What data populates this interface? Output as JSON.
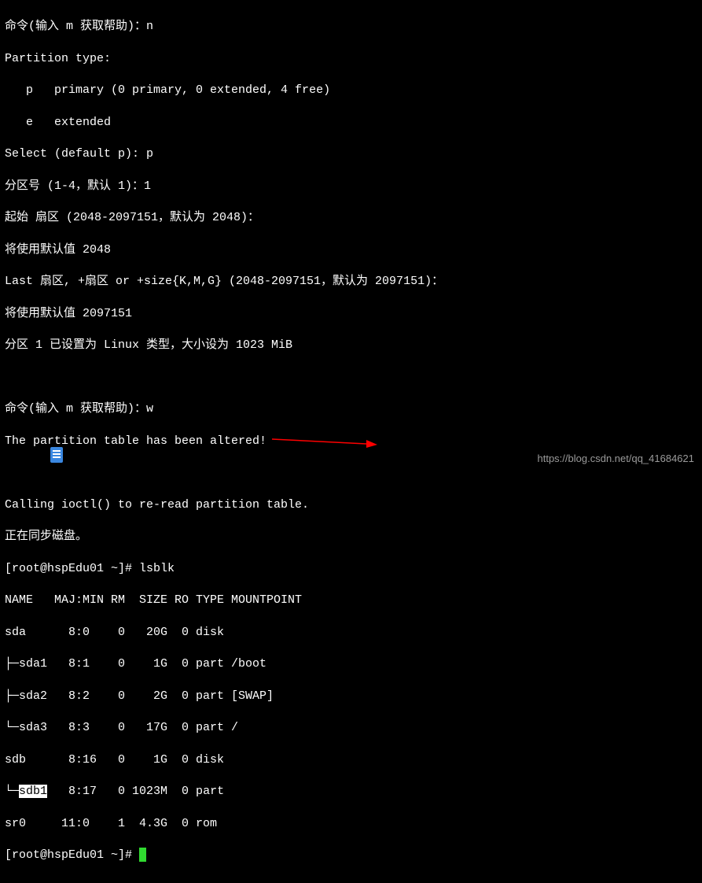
{
  "lines": {
    "l1": "命令(输入 m 获取帮助)：n",
    "l2": "Partition type:",
    "l3": "   p   primary (0 primary, 0 extended, 4 free)",
    "l4": "   e   extended",
    "l5": "Select (default p): p",
    "l6": "分区号 (1-4，默认 1)：1",
    "l7": "起始 扇区 (2048-2097151，默认为 2048)：",
    "l8": "将使用默认值 2048",
    "l9": "Last 扇区, +扇区 or +size{K,M,G} (2048-2097151，默认为 2097151)：",
    "l10": "将使用默认值 2097151",
    "l11": "分区 1 已设置为 Linux 类型，大小设为 1023 MiB",
    "l12": " ",
    "l13": "命令(输入 m 获取帮助)：w",
    "l14": "The partition table has been altered!",
    "l15": " ",
    "l16": "Calling ioctl() to re-read partition table.",
    "l17": "正在同步磁盘。",
    "l18": "[root@hspEdu01 ~]# lsblk",
    "l19": "NAME   MAJ:MIN RM  SIZE RO TYPE MOUNTPOINT",
    "l20": "sda      8:0    0   20G  0 disk ",
    "l21": "├─sda1   8:1    0    1G  0 part /boot",
    "l22": "├─sda2   8:2    0    2G  0 part [SWAP]",
    "l23": "└─sda3   8:3    0   17G  0 part /",
    "l24": "sdb      8:16   0    1G  0 disk ",
    "l25a": "└─",
    "l25b": "sdb1",
    "l25c": "   8:17   0 1023M  0 part ",
    "l26": "sr0     11:0    1  4.3G  0 rom  ",
    "l27": "[root@hspEdu01 ~]# "
  },
  "watermark": "https://blog.csdn.net/qq_41684621",
  "icons": {
    "doc": "document-icon",
    "arrow": "red-arrow"
  }
}
